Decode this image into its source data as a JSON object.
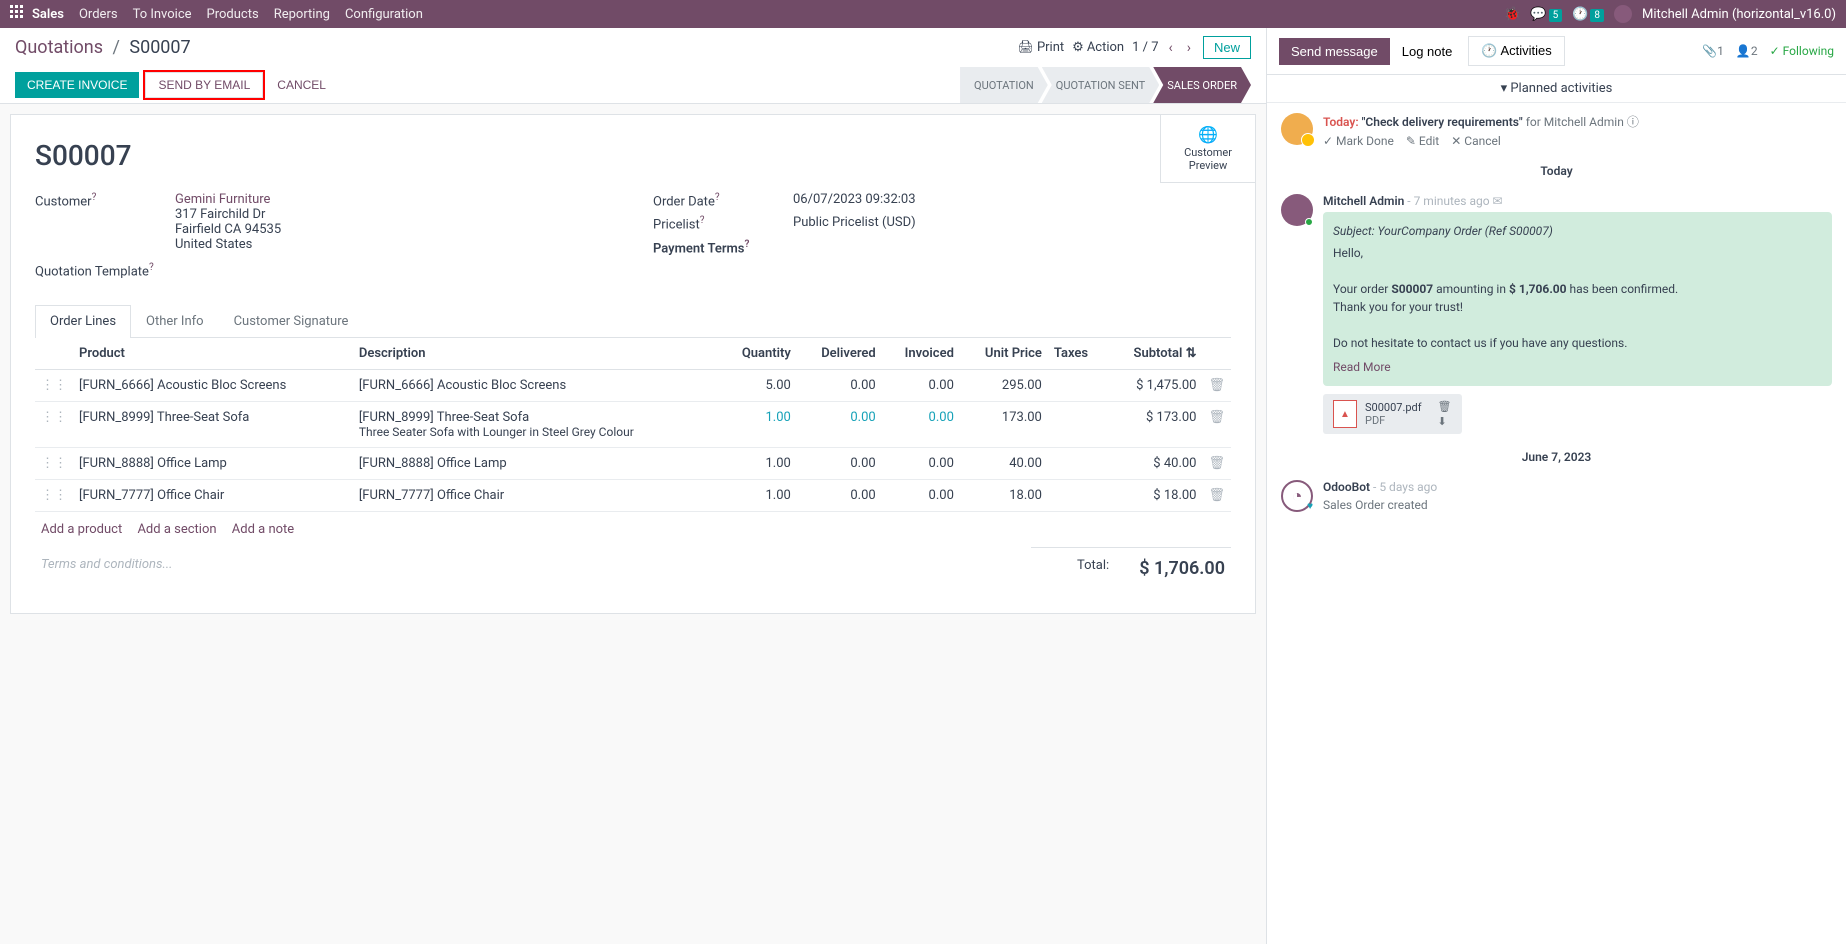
{
  "topnav": {
    "app": "Sales",
    "items": [
      "Orders",
      "To Invoice",
      "Products",
      "Reporting",
      "Configuration"
    ],
    "messages_badge": "5",
    "activities_badge": "8",
    "user": "Mitchell Admin (horizontal_v16.0)"
  },
  "breadcrumb": {
    "parent": "Quotations",
    "current": "S00007"
  },
  "toolbar": {
    "print": "Print",
    "action": "Action",
    "pager": "1 / 7",
    "new": "New"
  },
  "actions": {
    "create_invoice": "CREATE INVOICE",
    "send_email": "SEND BY EMAIL",
    "cancel": "CANCEL"
  },
  "status": [
    "QUOTATION",
    "QUOTATION SENT",
    "SALES ORDER"
  ],
  "status_active_index": 2,
  "sheet": {
    "preview": "Customer Preview",
    "title": "S00007",
    "customer_label": "Customer",
    "customer_name": "Gemini Furniture",
    "customer_addr1": "317 Fairchild Dr",
    "customer_addr2": "Fairfield CA 94535",
    "customer_addr3": "United States",
    "quotation_template_label": "Quotation Template",
    "order_date_label": "Order Date",
    "order_date": "06/07/2023 09:32:03",
    "pricelist_label": "Pricelist",
    "pricelist": "Public Pricelist (USD)",
    "payment_terms_label": "Payment Terms"
  },
  "tabs": [
    "Order Lines",
    "Other Info",
    "Customer Signature"
  ],
  "table": {
    "headers": [
      "Product",
      "Description",
      "Quantity",
      "Delivered",
      "Invoiced",
      "Unit Price",
      "Taxes",
      "Subtotal"
    ],
    "rows": [
      {
        "product": "[FURN_6666] Acoustic Bloc Screens",
        "desc": "[FURN_6666] Acoustic Bloc Screens",
        "desc_sub": "",
        "qty": "5.00",
        "delivered": "0.00",
        "invoiced": "0.00",
        "unit": "295.00",
        "taxes": "",
        "subtotal": "$ 1,475.00",
        "blue": false
      },
      {
        "product": "[FURN_8999] Three-Seat Sofa",
        "desc": "[FURN_8999] Three-Seat Sofa",
        "desc_sub": "Three Seater Sofa with Lounger in Steel Grey Colour",
        "qty": "1.00",
        "delivered": "0.00",
        "invoiced": "0.00",
        "unit": "173.00",
        "taxes": "",
        "subtotal": "$ 173.00",
        "blue": true
      },
      {
        "product": "[FURN_8888] Office Lamp",
        "desc": "[FURN_8888] Office Lamp",
        "desc_sub": "",
        "qty": "1.00",
        "delivered": "0.00",
        "invoiced": "0.00",
        "unit": "40.00",
        "taxes": "",
        "subtotal": "$ 40.00",
        "blue": false
      },
      {
        "product": "[FURN_7777] Office Chair",
        "desc": "[FURN_7777] Office Chair",
        "desc_sub": "",
        "qty": "1.00",
        "delivered": "0.00",
        "invoiced": "0.00",
        "unit": "18.00",
        "taxes": "",
        "subtotal": "$ 18.00",
        "blue": false
      }
    ],
    "add_product": "Add a product",
    "add_section": "Add a section",
    "add_note": "Add a note",
    "terms_placeholder": "Terms and conditions...",
    "total_label": "Total:",
    "total_value": "$ 1,706.00"
  },
  "chatter": {
    "send": "Send message",
    "log": "Log note",
    "activities": "Activities",
    "attach_count": "1",
    "follower_count": "2",
    "following": "Following",
    "planned": "Planned activities",
    "activity": {
      "today": "Today:",
      "title": "\"Check delivery requirements\"",
      "for": "for Mitchell Admin",
      "mark_done": "Mark Done",
      "edit": "Edit",
      "cancel": "Cancel"
    },
    "sep1": "Today",
    "msg": {
      "name": "Mitchell Admin",
      "time": "- 7 minutes ago",
      "subject": "Subject: YourCompany Order (Ref S00007)",
      "hello": "Hello,",
      "body1_a": "Your order ",
      "body1_b": "S00007",
      "body1_c": " amounting in ",
      "body1_d": "$ 1,706.00",
      "body1_e": " has been confirmed.",
      "body2": "Thank you for your trust!",
      "body3": "Do not hesitate to contact us if you have any questions.",
      "read_more": "Read More",
      "att_name": "S00007.pdf",
      "att_type": "PDF"
    },
    "sep2": "June 7, 2023",
    "sys": {
      "name": "OdooBot",
      "time": "- 5 days ago",
      "text": "Sales Order created"
    }
  }
}
